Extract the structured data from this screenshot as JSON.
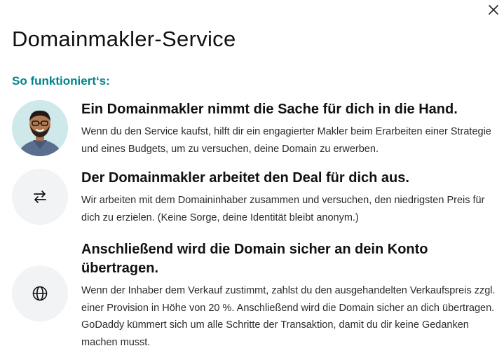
{
  "modal": {
    "title": "Domainmakler-Service",
    "subtitle": "So funktioniert‘s:",
    "close_icon": "close-icon"
  },
  "steps": [
    {
      "icon": "broker-avatar",
      "heading": "Ein Domainmakler nimmt die Sache für dich in die Hand.",
      "text": "Wenn du den Service kaufst, hilft dir ein engagierter Makler beim Erarbeiten einer Strategie und eines Budgets, um zu versuchen, deine Domain zu erwerben."
    },
    {
      "icon": "swap-arrows-icon",
      "heading": "Der Domainmakler arbeitet den Deal für dich aus.",
      "text": "Wir arbeiten mit dem Domaininhaber zusammen und versuchen, den niedrigsten Preis für dich zu erzielen. (Keine Sorge, deine Identität bleibt anonym.)"
    },
    {
      "icon": "globe-icon",
      "heading": "Anschließend wird die Domain sicher an dein Konto übertragen.",
      "text": "Wenn der Inhaber dem Verkauf zustimmt, zahlst du den ausgehandelten Verkaufspreis zzgl. einer Provision in Höhe von 20 %. Anschließend wird die Domain sicher an dich übertragen. GoDaddy kümmert sich um alle Schritte der Transaktion, damit du dir keine Gedanken machen musst."
    }
  ],
  "colors": {
    "accent": "#00838c",
    "badge_background": "#f1f3f5",
    "avatar_background": "#cfe9ea",
    "text": "#111111"
  }
}
